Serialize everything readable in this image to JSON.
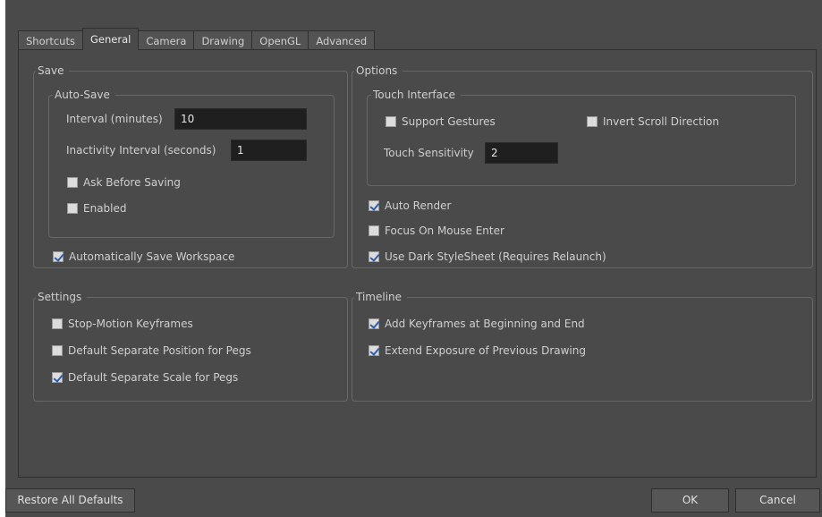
{
  "tabs": [
    "Shortcuts",
    "General",
    "Camera",
    "Drawing",
    "OpenGL",
    "Advanced"
  ],
  "active_tab": "General",
  "save": {
    "title": "Save",
    "autosave": {
      "title": "Auto-Save",
      "interval_label": "Interval (minutes)",
      "interval_value": "10",
      "inactivity_label": "Inactivity Interval (seconds)",
      "inactivity_value": "1",
      "ask_before_saving": "Ask Before Saving",
      "enabled": "Enabled"
    },
    "auto_save_workspace": "Automatically Save Workspace"
  },
  "options": {
    "title": "Options",
    "touch": {
      "title": "Touch Interface",
      "support_gestures": "Support Gestures",
      "invert_scroll": "Invert Scroll Direction",
      "sensitivity_label": "Touch Sensitivity",
      "sensitivity_value": "2"
    },
    "auto_render": "Auto Render",
    "focus_on_mouse_enter": "Focus On Mouse Enter",
    "dark_stylesheet": "Use Dark StyleSheet (Requires Relaunch)"
  },
  "settings": {
    "title": "Settings",
    "stop_motion": "Stop-Motion Keyframes",
    "sep_position": "Default Separate Position for Pegs",
    "sep_scale": "Default Separate Scale for Pegs"
  },
  "timeline": {
    "title": "Timeline",
    "add_keyframes": "Add Keyframes at Beginning and End",
    "extend_exposure": "Extend Exposure of Previous Drawing"
  },
  "buttons": {
    "restore": "Restore All Defaults",
    "ok": "OK",
    "cancel": "Cancel"
  },
  "checkbox_states": {
    "ask_before_saving": false,
    "enabled": false,
    "auto_save_workspace": true,
    "support_gestures": false,
    "invert_scroll": false,
    "auto_render": true,
    "focus_on_mouse_enter": false,
    "dark_stylesheet": true,
    "stop_motion": false,
    "sep_position": false,
    "sep_scale": true,
    "add_keyframes": true,
    "extend_exposure": true
  },
  "colors": {
    "background": "#4a4a4a",
    "field_background": "#1f1f1f",
    "checkmark": "#2f5da8"
  }
}
